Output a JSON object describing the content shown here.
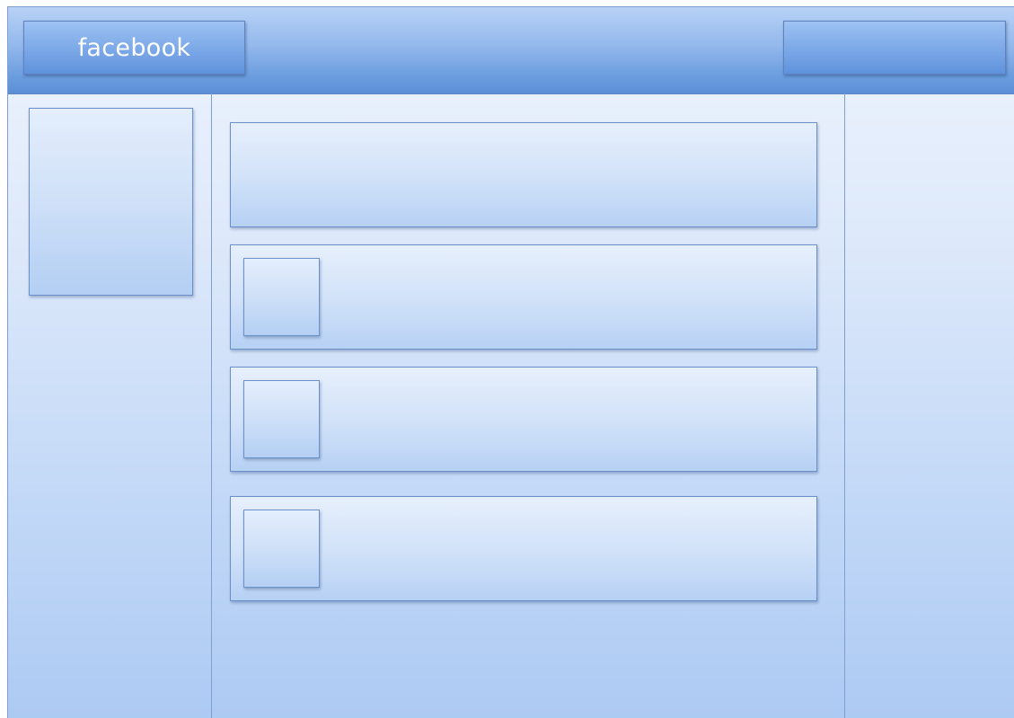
{
  "header": {
    "logo_text": "facebook"
  }
}
